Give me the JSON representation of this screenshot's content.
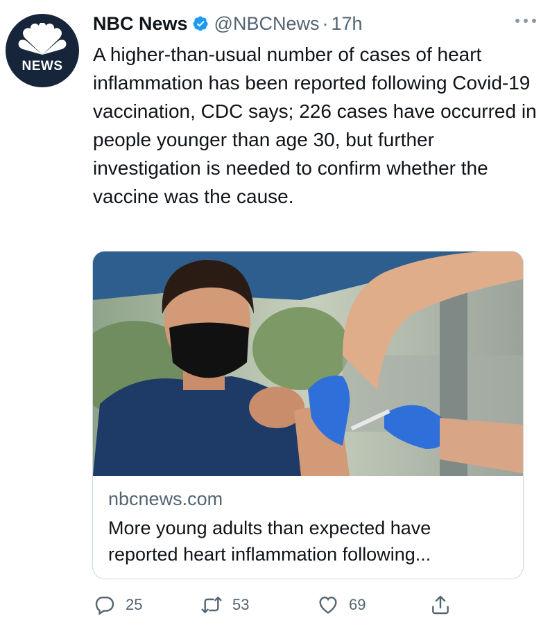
{
  "tweet": {
    "author": {
      "name": "NBC News",
      "handle": "@NBCNews",
      "separator": "·",
      "time": "17h",
      "avatar_text": "NEWS",
      "avatar_icon": "peacock-logo",
      "verified_icon": "verified-badge-icon"
    },
    "text": "A higher-than-usual number of cases of heart inflammation has been reported following Covid-19 vaccination, CDC says; 226 cases have occurred in people younger than age 30, but further investigation is needed to confirm whether the vaccine was the cause.",
    "card": {
      "domain": "nbcnews.com",
      "title": "More young adults than expected have\nreported heart inflammation following..."
    },
    "actions": {
      "replies": "25",
      "retweets": "53",
      "likes": "69"
    }
  },
  "colors": {
    "text": "#0f1419",
    "secondary": "#536471",
    "verified": "#1d9bf0",
    "border": "#cfd9de",
    "avatar_bg": "#17253a"
  }
}
